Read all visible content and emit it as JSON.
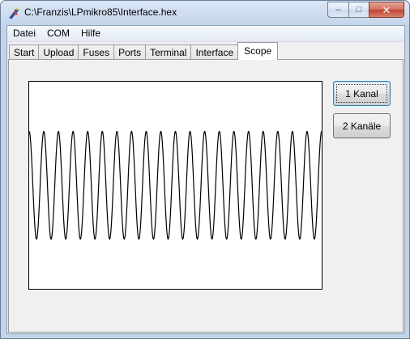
{
  "window": {
    "title": "C:\\Franzis\\LPmikro85\\Interface.hex",
    "min_glyph": "–",
    "max_glyph": "□",
    "close_glyph": "✕"
  },
  "menu": [
    "Datei",
    "COM",
    "Hilfe"
  ],
  "tabs": [
    "Start",
    "Upload",
    "Fuses",
    "Ports",
    "Terminal",
    "Interface",
    "Scope"
  ],
  "active_tab": "Scope",
  "buttons": {
    "channel1": "1 Kanal",
    "channel2": "2 Kanäle"
  },
  "scope": {
    "background": "#ffffff",
    "trace_color": "#000000",
    "cycles": 20,
    "amplitude_fraction": 0.52,
    "center_fraction": 0.5
  },
  "colors": {
    "title_gradient_top": "#dbe7f5",
    "close_button": "#c24431",
    "client_bg": "#f0f0f0"
  }
}
